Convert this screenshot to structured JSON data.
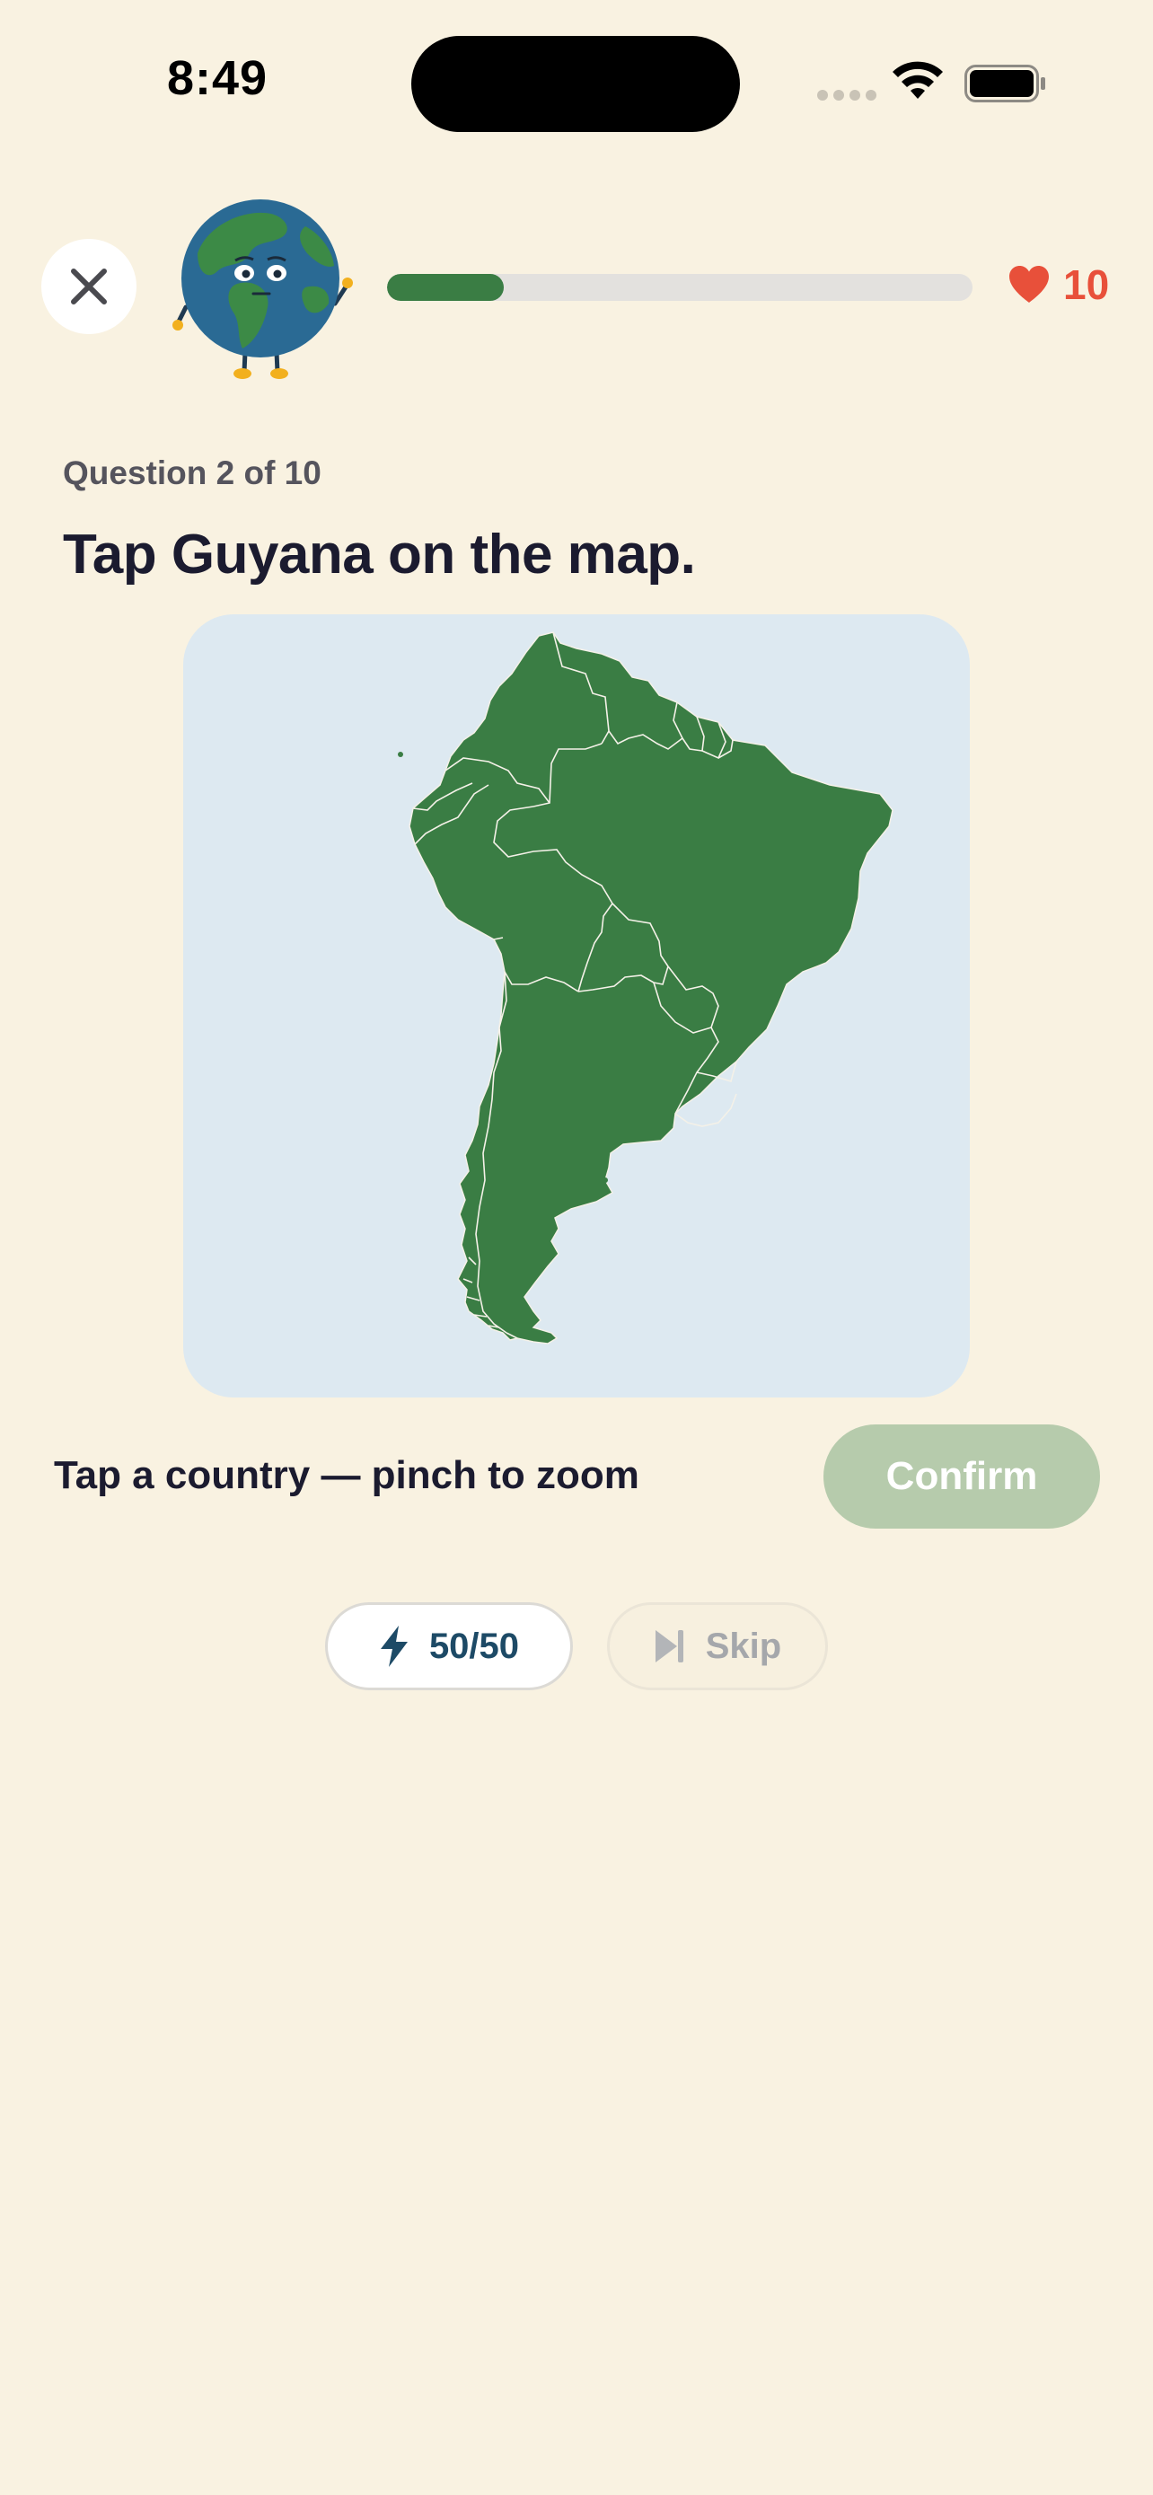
{
  "status_bar": {
    "time": "8:49"
  },
  "header": {
    "progress_fraction": 0.2,
    "lives_count": "10",
    "progress_color": "#3a7d44",
    "lives_color": "#e8503a"
  },
  "question": {
    "counter": "Question 2 of 10",
    "prompt": "Tap Guyana on the map."
  },
  "map": {
    "region": "South America",
    "land_color": "#3a7d44",
    "water_color": "#dde9f1"
  },
  "footer": {
    "hint": "Tap a country — pinch to zoom",
    "confirm_label": "Confirm"
  },
  "lifelines": {
    "fifty_fifty_label": "50/50",
    "skip_label": "Skip"
  },
  "icons": {
    "close": "close-icon",
    "heart": "heart-icon",
    "bolt": "lightning-icon",
    "skip": "skip-icon",
    "wifi": "wifi-icon",
    "battery": "battery-icon",
    "mascot": "earth-mascot-icon"
  }
}
